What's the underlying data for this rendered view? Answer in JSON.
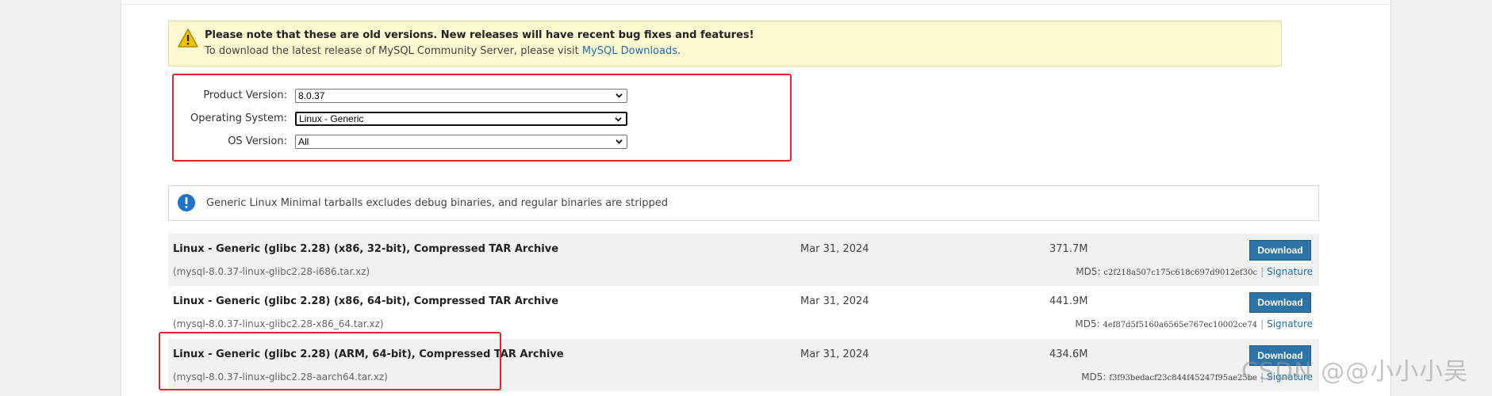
{
  "notice": {
    "title": "Please note that these are old versions. New releases will have recent bug fixes and features!",
    "text": "To download the latest release of MySQL Community Server, please visit ",
    "link": "MySQL Downloads",
    "suffix": ".",
    "icon": "warning-icon"
  },
  "selectors": [
    {
      "label": "Product Version:",
      "value": "8.0.37"
    },
    {
      "label": "Operating System:",
      "value": "Linux - Generic"
    },
    {
      "label": "OS Version:",
      "value": "All"
    }
  ],
  "info": {
    "icon": "info-icon",
    "text": "Generic Linux Minimal tarballs excludes debug binaries, and regular binaries are stripped"
  },
  "rows": [
    {
      "title": "Linux - Generic (glibc 2.28) (x86, 32-bit), Compressed TAR Archive",
      "file": "(mysql-8.0.37-linux-glibc2.28-i686.tar.xz)",
      "date": "Mar 31, 2024",
      "size": "371.7M",
      "button": "Download",
      "md5_label": "MD5:",
      "md5": "c2f218a507c175c618c697d9012ef30c",
      "sep": "|",
      "signature": "Signature"
    },
    {
      "title": "Linux - Generic (glibc 2.28) (x86, 64-bit), Compressed TAR Archive",
      "file": "(mysql-8.0.37-linux-glibc2.28-x86_64.tar.xz)",
      "date": "Mar 31, 2024",
      "size": "441.9M",
      "button": "Download",
      "md5_label": "MD5:",
      "md5": "4ef87d5f5160a6565e767ec10002ce74",
      "sep": "|",
      "signature": "Signature"
    },
    {
      "title": "Linux - Generic (glibc 2.28) (ARM, 64-bit), Compressed TAR Archive",
      "file": "(mysql-8.0.37-linux-glibc2.28-aarch64.tar.xz)",
      "date": "Mar 31, 2024",
      "size": "434.6M",
      "button": "Download",
      "md5_label": "MD5:",
      "md5": "f3f93bedacf23c844f45247f95ae25be",
      "sep": "|",
      "signature": "Signature"
    }
  ],
  "watermark": "CSDN @@小小小吴",
  "colors": {
    "accent": "#2c74a8",
    "link": "#1e6fb1",
    "notice_bg": "#fcf8cf",
    "highlight": "#e3262b"
  }
}
